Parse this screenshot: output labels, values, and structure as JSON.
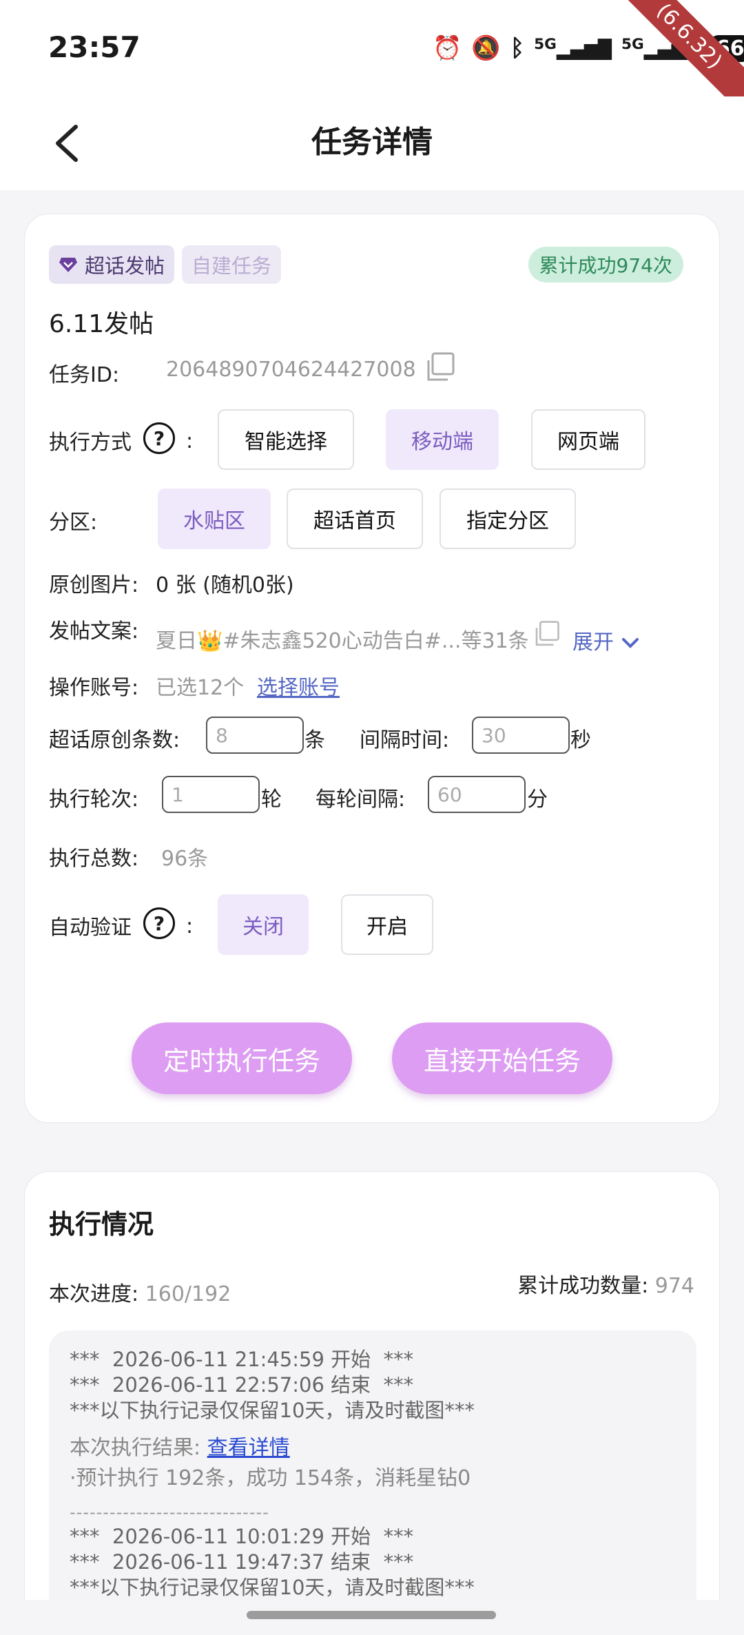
{
  "status": {
    "time": "23:57",
    "battery": "66",
    "network1": "5G",
    "network2": "5G",
    "version": "(6.6.32)"
  },
  "nav": {
    "title": "任务详情"
  },
  "task": {
    "tag_super": "超话发帖",
    "tag_self": "自建任务",
    "success_badge": "累计成功974次",
    "name": "6.11发帖",
    "id_label": "任务ID:",
    "id_value": "2064890704624427008",
    "exec_mode_label": "执行方式",
    "exec_mode_colon": ":",
    "exec_modes": [
      "智能选择",
      "移动端",
      "网页端"
    ],
    "partition_label": "分区:",
    "partitions": [
      "水贴区",
      "超话首页",
      "指定分区"
    ],
    "images_label": "原创图片:",
    "images_value": "0 张 (随机0张)",
    "copy_label": "发帖文案:",
    "copy_value": "夏日👑#朱志鑫520心动告白#...等31条",
    "expand_label": "展开",
    "account_label": "操作账号:",
    "account_value": "已选12个",
    "account_link": "选择账号",
    "original_count_label": "超话原创条数:",
    "original_count_value": "8",
    "original_count_unit": "条",
    "interval_label": "间隔时间:",
    "interval_value": "30",
    "interval_unit": "秒",
    "rounds_label": "执行轮次:",
    "rounds_value": "1",
    "rounds_unit": "轮",
    "round_interval_label": "每轮间隔:",
    "round_interval_value": "60",
    "round_interval_unit": "分",
    "total_label": "执行总数:",
    "total_value": "96条",
    "auto_verify_label": "自动验证",
    "auto_verify_colon": ":",
    "auto_verify_options": [
      "关闭",
      "开启"
    ],
    "schedule_button": "定时执行任务",
    "start_button": "直接开始任务"
  },
  "execution": {
    "title": "执行情况",
    "progress_label": "本次进度:",
    "progress_value": "160/192",
    "total_success_label": "累计成功数量:",
    "total_success_value": "974",
    "log": {
      "block1_start": "***  2026-06-11 21:45:59 开始  ***",
      "block1_end": "***  2026-06-11 22:57:06 结束  ***",
      "block1_note": "***以下执行记录仅保留10天，请及时截图***",
      "result_label": "本次执行结果:",
      "result_link": "查看详情",
      "result_detail": "·预计执行 192条，成功 154条，消耗星钻0",
      "divider": "------------------------------",
      "block2_start": "***  2026-06-11 10:01:29 开始  ***",
      "block2_end": "***  2026-06-11 19:47:37 结束  ***",
      "block2_note": "***以下执行记录仅保留10天，请及时截图***"
    }
  }
}
